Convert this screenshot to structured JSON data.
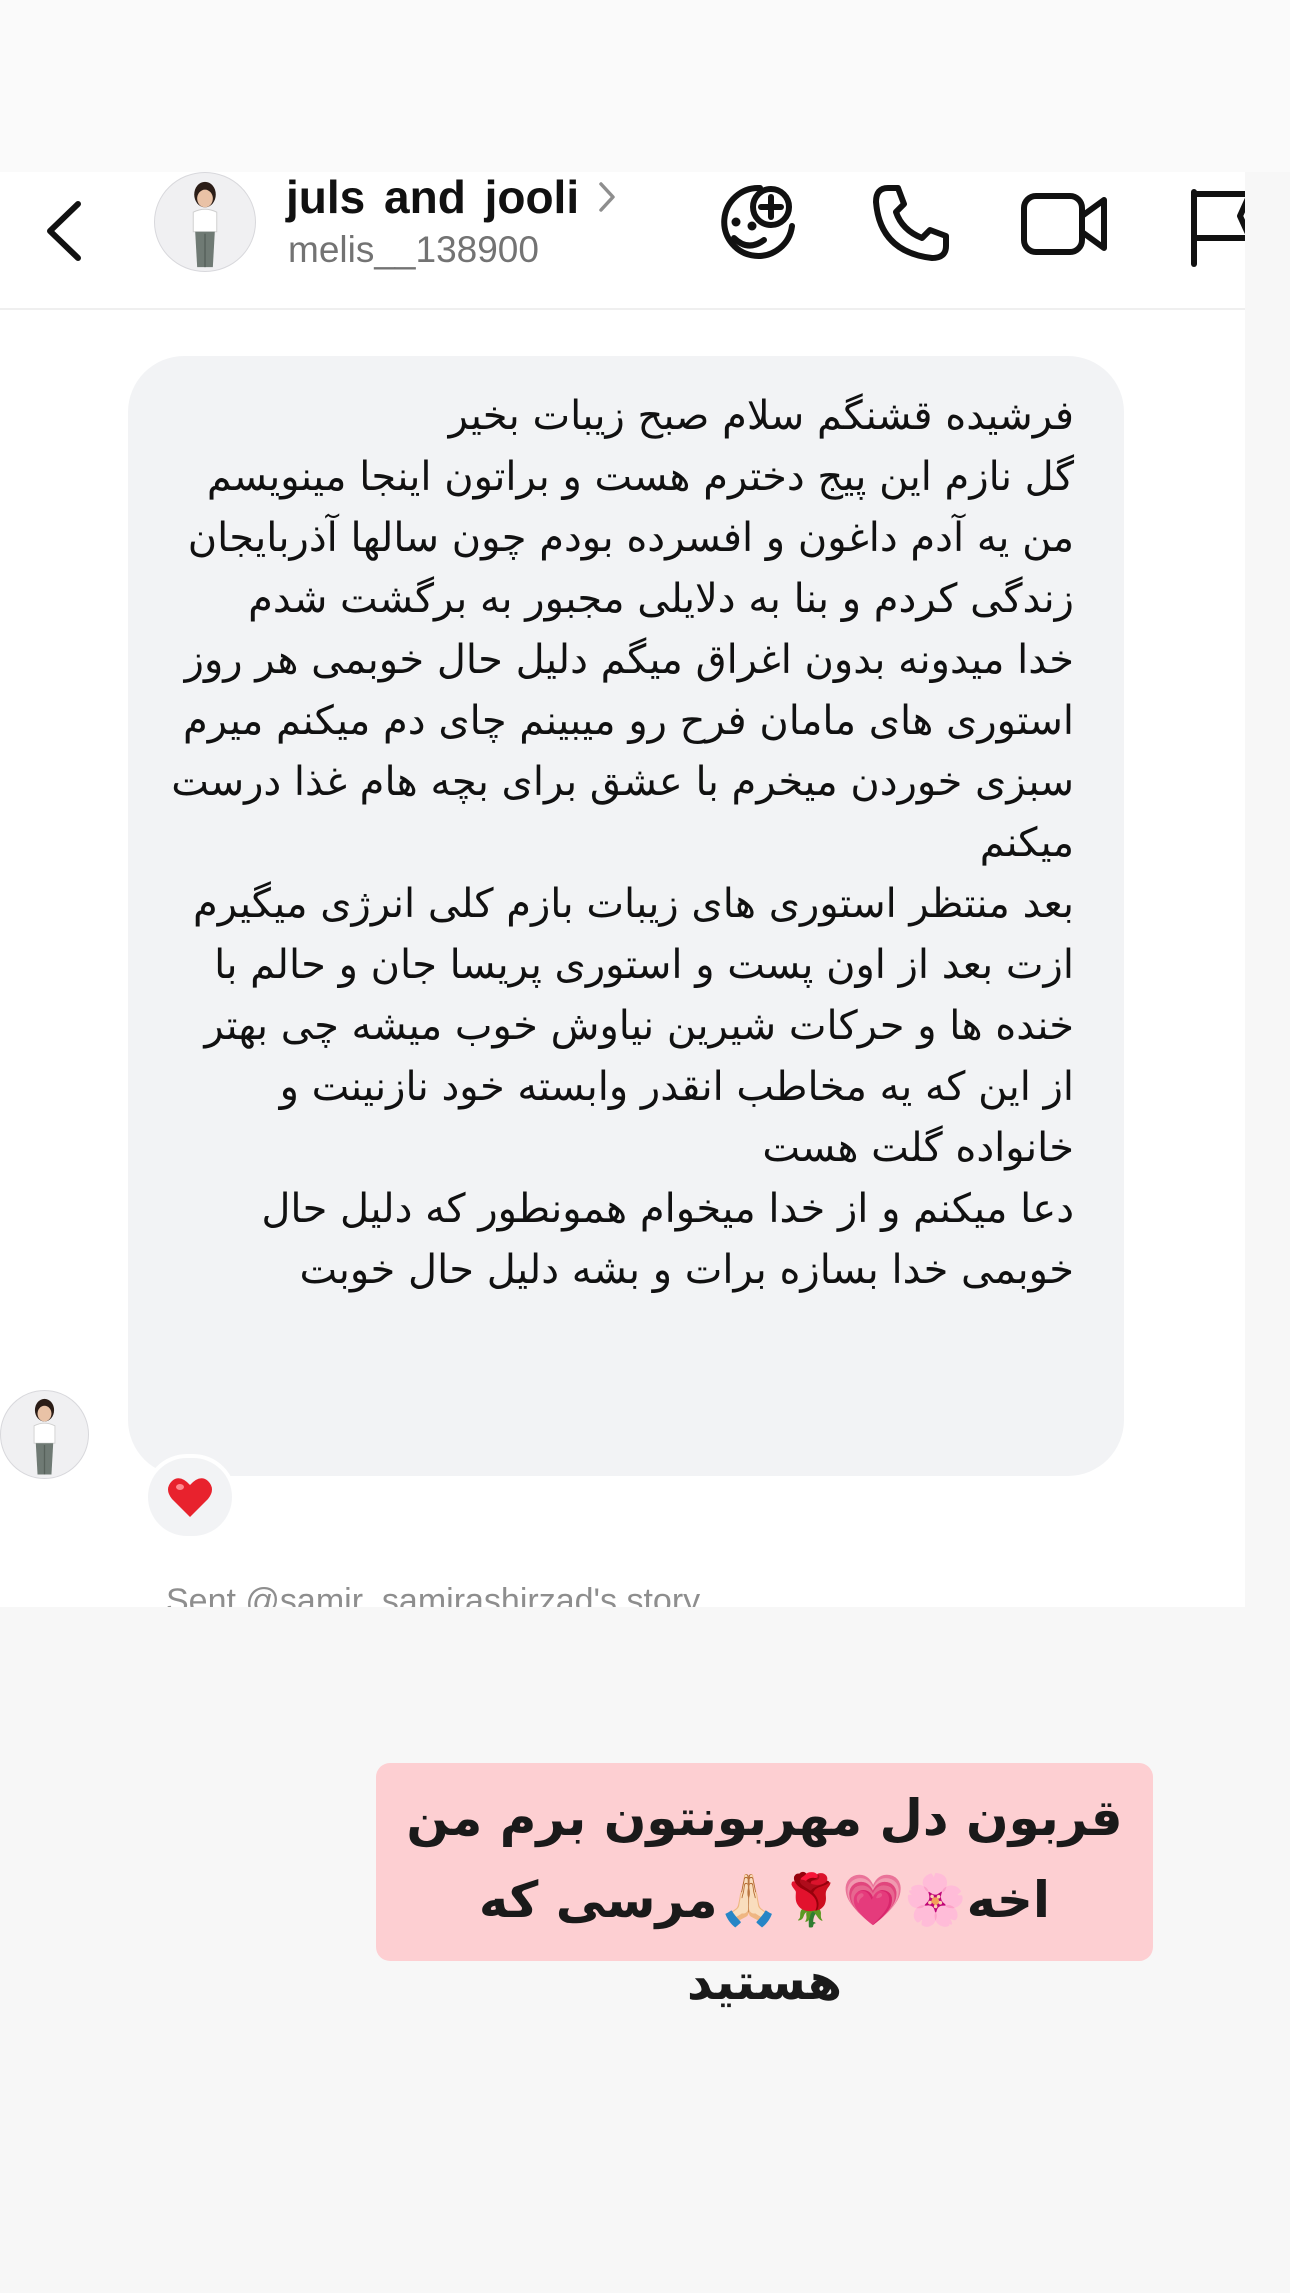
{
  "header": {
    "title": "juls and jooli",
    "username": "melis__138900"
  },
  "message": {
    "paragraphs": [
      "فرشیده قشنگم سلام صبح زیبات بخیر",
      "گل نازم این پیج دخترم هست و براتون اینجا مینویسم من یه آدم داغون و افسرده بودم چون سالها آذربایجان زندگی کردم و بنا به دلایلی مجبور به برگشت شدم",
      "خدا میدونه بدون اغراق میگم دلیل حال خوبمی هر روز استوری های مامان فرح رو میبینم چای دم میکنم میرم سبزی خوردن میخرم با عشق برای بچه هام غذا درست میکنم",
      "بعد منتظر استوری های زیبات بازم کلی انرژی میگیرم ازت بعد از اون پست و استوری پریسا جان و حالم با خنده ها و حرکات شیرین نیاوش خوب میشه چی بهتر از این که یه مخاطب انقدر وابسته خود نازنینت و خانواده گلت هست",
      "دعا میکنم و از خدا میخوام همونطور که دلیل حال خوبمی خدا بسازه برات و بشه دلیل حال خوبت"
    ],
    "reaction": "❤️",
    "story_caption": "Sent @samir_samirashirzad's story"
  },
  "reply": {
    "line1": "قربون دل مهربونتون برم من",
    "line2": "اخه🌸💗🌹🙏🏻مرسی که هستید"
  },
  "icons": {
    "back": "chevron-left-icon",
    "title_chevron": "chevron-right-icon",
    "effects": "sticker-face-plus-icon",
    "call": "phone-icon",
    "video": "video-camera-icon",
    "report": "flag-icon",
    "reaction": "red-heart-icon"
  },
  "colors": {
    "bubble": "#f2f3f5",
    "reply_bg": "#fdcfd2",
    "page_bg": "#f7f7f7",
    "username": "#737373",
    "caption": "#8e8e8e"
  }
}
